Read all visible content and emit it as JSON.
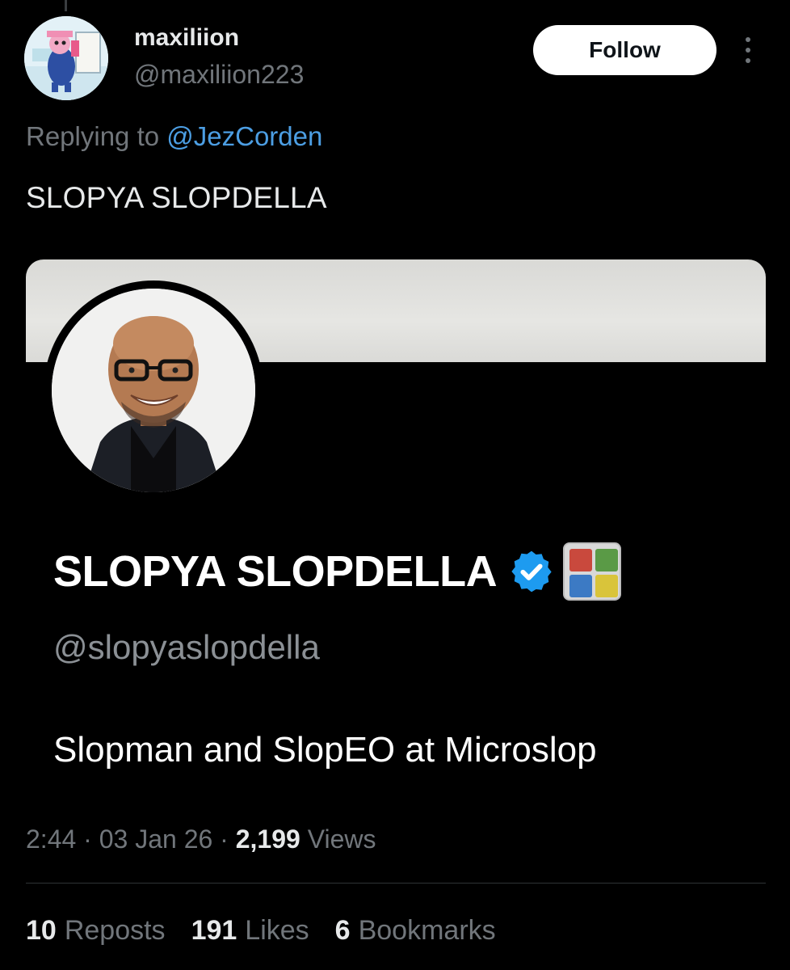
{
  "author": {
    "name": "maxiliion",
    "handle": "@maxiliion223"
  },
  "follow_label": "Follow",
  "reply": {
    "prefix": "Replying to ",
    "mention": "@JezCorden"
  },
  "tweet_text": "SLOPYA SLOPDELLA",
  "embedded_profile": {
    "display_name": "SLOPYA SLOPDELLA",
    "handle": "@slopyaslopdella",
    "bio": "Slopman and SlopEO at Microslop"
  },
  "meta": {
    "time": "2:44",
    "date": "03 Jan 26",
    "views_count": "2,199",
    "views_label": "Views",
    "sep": " · "
  },
  "stats": {
    "reposts_count": "10",
    "reposts_label": "Reposts",
    "likes_count": "191",
    "likes_label": "Likes",
    "bookmarks_count": "6",
    "bookmarks_label": "Bookmarks"
  },
  "colors": {
    "background": "#000000",
    "link": "#4c9ee3",
    "muted": "#71767b",
    "verified": "#1d9bf0"
  },
  "icons": [
    "more-icon",
    "verified-badge-icon",
    "affiliate-badge-icon"
  ]
}
